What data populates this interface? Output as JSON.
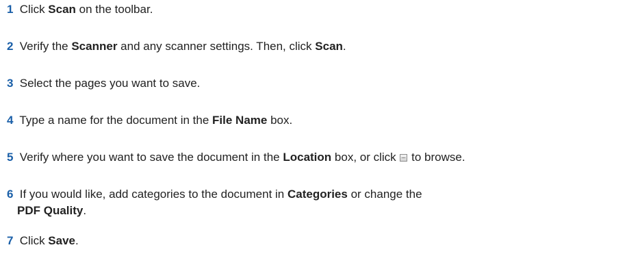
{
  "steps": [
    {
      "num": "1",
      "parts": [
        "Click ",
        "Scan",
        " on the toolbar."
      ]
    },
    {
      "num": "2",
      "parts": [
        "Verify the ",
        "Scanner",
        " and any scanner settings. Then, click ",
        "Scan",
        "."
      ]
    },
    {
      "num": "3",
      "parts": [
        "Select the pages you want to save."
      ]
    },
    {
      "num": "4",
      "parts": [
        "Type a name for the document in the ",
        "File Name",
        " box."
      ]
    },
    {
      "num": "5",
      "parts": [
        "Verify where you want to save the document in the ",
        "Location",
        " box, or click ",
        " to browse."
      ],
      "icon": "browse-button-icon"
    },
    {
      "num": "6",
      "line1": [
        "If you would like, add categories to the document in ",
        "Categories",
        " or change the"
      ],
      "line2": [
        "PDF Quality",
        "."
      ]
    },
    {
      "num": "7",
      "parts": [
        "Click ",
        "Save",
        "."
      ]
    }
  ]
}
